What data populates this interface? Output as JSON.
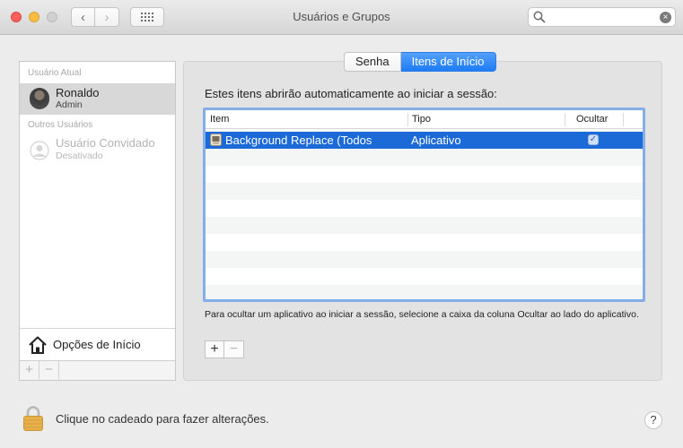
{
  "window": {
    "title": "Usuários e Grupos",
    "back_glyph": "‹",
    "forward_glyph": "›",
    "search": {
      "placeholder": "",
      "value": ""
    },
    "clear_glyph": "×"
  },
  "sidebar": {
    "current_user_header": "Usuário Atual",
    "current_user": {
      "name": "Ronaldo",
      "role": "Admin"
    },
    "other_users_header": "Outros Usuários",
    "guest_user": {
      "name": "Usuário Convidado",
      "status": "Desativado"
    },
    "login_options_label": "Opções de Início",
    "add_glyph": "+",
    "remove_glyph": "−"
  },
  "tabs": [
    {
      "label": "Senha",
      "active": false
    },
    {
      "label": "Itens de Início",
      "active": true
    }
  ],
  "login_items": {
    "description": "Estes itens abrirão automaticamente ao iniciar a sessão:",
    "columns": [
      "Item",
      "Tipo",
      "Ocultar"
    ],
    "rows": [
      {
        "item": "Background Replace (Todos",
        "type": "Aplicativo",
        "hide": true
      }
    ],
    "hint": "Para ocultar um aplicativo ao iniciar a sessão, selecione a caixa da coluna Ocultar ao lado do aplicativo.",
    "add_glyph": "+",
    "remove_glyph": "−"
  },
  "footer": {
    "lock_text": "Clique no cadeado para fazer alterações.",
    "help_glyph": "?"
  },
  "colors": {
    "accent": "#1f7cf4",
    "selection": "#1c6ad8",
    "close": "#fc605c",
    "minimize": "#fdbc40",
    "lock": "#e8b04a"
  },
  "icons": [
    "search-icon",
    "clear-icon",
    "grid-icon",
    "house-icon",
    "lock-icon",
    "help-icon",
    "guest-user-icon",
    "app-icon",
    "checkmark-icon"
  ]
}
